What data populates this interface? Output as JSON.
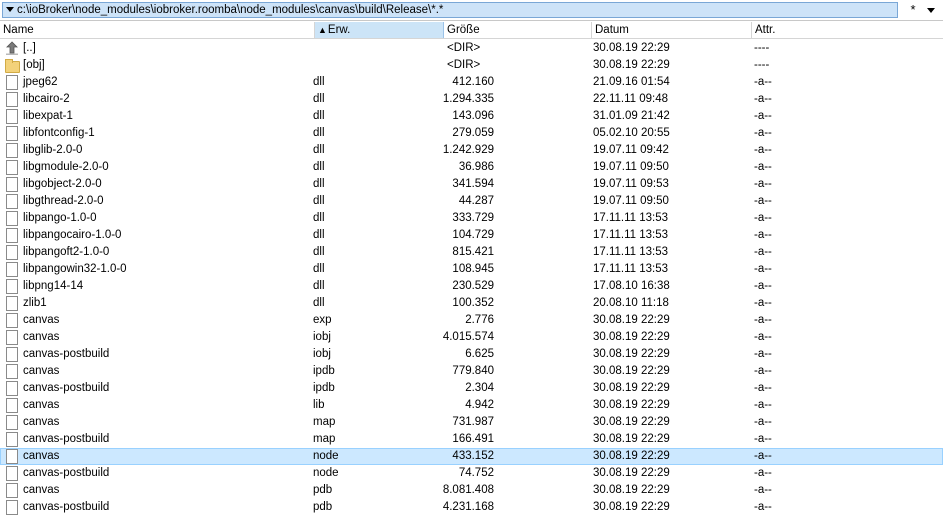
{
  "pathbar": {
    "path": "c:\\ioBroker\\node_modules\\iobroker.roomba\\node_modules\\canvas\\build\\Release\\*.*",
    "filter_glyph": "*"
  },
  "columns": {
    "name": "Name",
    "ext": "Erw.",
    "size": "Größe",
    "date": "Datum",
    "attr": "Attr."
  },
  "sort": {
    "column": "ext",
    "direction": "up-arrow"
  },
  "rows": [
    {
      "icon": "up-dir-icon",
      "name": "[..]",
      "ext": "",
      "size": "<DIR>",
      "date": "30.08.19 22:29",
      "attr": "----",
      "dir": true
    },
    {
      "icon": "folder-icon",
      "name": "[obj]",
      "ext": "",
      "size": "<DIR>",
      "date": "30.08.19 22:29",
      "attr": "----",
      "dir": true
    },
    {
      "icon": "file-icon",
      "name": "jpeg62",
      "ext": "dll",
      "size": "412.160",
      "date": "21.09.16 01:54",
      "attr": "-a--"
    },
    {
      "icon": "file-icon",
      "name": "libcairo-2",
      "ext": "dll",
      "size": "1.294.335",
      "date": "22.11.11 09:48",
      "attr": "-a--"
    },
    {
      "icon": "file-icon",
      "name": "libexpat-1",
      "ext": "dll",
      "size": "143.096",
      "date": "31.01.09 21:42",
      "attr": "-a--"
    },
    {
      "icon": "file-icon",
      "name": "libfontconfig-1",
      "ext": "dll",
      "size": "279.059",
      "date": "05.02.10 20:55",
      "attr": "-a--"
    },
    {
      "icon": "file-icon",
      "name": "libglib-2.0-0",
      "ext": "dll",
      "size": "1.242.929",
      "date": "19.07.11 09:42",
      "attr": "-a--"
    },
    {
      "icon": "file-icon",
      "name": "libgmodule-2.0-0",
      "ext": "dll",
      "size": "36.986",
      "date": "19.07.11 09:50",
      "attr": "-a--"
    },
    {
      "icon": "file-icon",
      "name": "libgobject-2.0-0",
      "ext": "dll",
      "size": "341.594",
      "date": "19.07.11 09:53",
      "attr": "-a--"
    },
    {
      "icon": "file-icon",
      "name": "libgthread-2.0-0",
      "ext": "dll",
      "size": "44.287",
      "date": "19.07.11 09:50",
      "attr": "-a--"
    },
    {
      "icon": "file-icon",
      "name": "libpango-1.0-0",
      "ext": "dll",
      "size": "333.729",
      "date": "17.11.11 13:53",
      "attr": "-a--"
    },
    {
      "icon": "file-icon",
      "name": "libpangocairo-1.0-0",
      "ext": "dll",
      "size": "104.729",
      "date": "17.11.11 13:53",
      "attr": "-a--"
    },
    {
      "icon": "file-icon",
      "name": "libpangoft2-1.0-0",
      "ext": "dll",
      "size": "815.421",
      "date": "17.11.11 13:53",
      "attr": "-a--"
    },
    {
      "icon": "file-icon",
      "name": "libpangowin32-1.0-0",
      "ext": "dll",
      "size": "108.945",
      "date": "17.11.11 13:53",
      "attr": "-a--"
    },
    {
      "icon": "file-icon",
      "name": "libpng14-14",
      "ext": "dll",
      "size": "230.529",
      "date": "17.08.10 16:38",
      "attr": "-a--"
    },
    {
      "icon": "file-icon",
      "name": "zlib1",
      "ext": "dll",
      "size": "100.352",
      "date": "20.08.10 11:18",
      "attr": "-a--"
    },
    {
      "icon": "file-icon",
      "name": "canvas",
      "ext": "exp",
      "size": "2.776",
      "date": "30.08.19 22:29",
      "attr": "-a--"
    },
    {
      "icon": "file-icon",
      "name": "canvas",
      "ext": "iobj",
      "size": "4.015.574",
      "date": "30.08.19 22:29",
      "attr": "-a--"
    },
    {
      "icon": "file-icon",
      "name": "canvas-postbuild",
      "ext": "iobj",
      "size": "6.625",
      "date": "30.08.19 22:29",
      "attr": "-a--"
    },
    {
      "icon": "file-icon",
      "name": "canvas",
      "ext": "ipdb",
      "size": "779.840",
      "date": "30.08.19 22:29",
      "attr": "-a--"
    },
    {
      "icon": "file-icon",
      "name": "canvas-postbuild",
      "ext": "ipdb",
      "size": "2.304",
      "date": "30.08.19 22:29",
      "attr": "-a--"
    },
    {
      "icon": "file-icon",
      "name": "canvas",
      "ext": "lib",
      "size": "4.942",
      "date": "30.08.19 22:29",
      "attr": "-a--"
    },
    {
      "icon": "file-icon",
      "name": "canvas",
      "ext": "map",
      "size": "731.987",
      "date": "30.08.19 22:29",
      "attr": "-a--"
    },
    {
      "icon": "file-icon",
      "name": "canvas-postbuild",
      "ext": "map",
      "size": "166.491",
      "date": "30.08.19 22:29",
      "attr": "-a--"
    },
    {
      "icon": "file-icon",
      "name": "canvas",
      "ext": "node",
      "size": "433.152",
      "date": "30.08.19 22:29",
      "attr": "-a--",
      "selected": true
    },
    {
      "icon": "file-icon",
      "name": "canvas-postbuild",
      "ext": "node",
      "size": "74.752",
      "date": "30.08.19 22:29",
      "attr": "-a--"
    },
    {
      "icon": "file-icon",
      "name": "canvas",
      "ext": "pdb",
      "size": "8.081.408",
      "date": "30.08.19 22:29",
      "attr": "-a--"
    },
    {
      "icon": "file-icon",
      "name": "canvas-postbuild",
      "ext": "pdb",
      "size": "4.231.168",
      "date": "30.08.19 22:29",
      "attr": "-a--"
    }
  ]
}
